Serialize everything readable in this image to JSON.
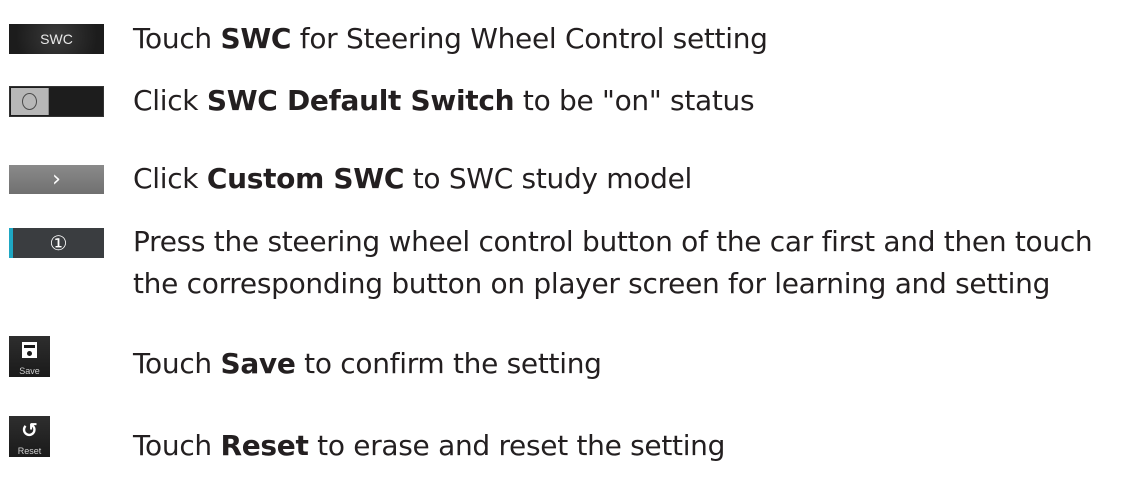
{
  "rows": [
    {
      "icon": {
        "name": "swc-button",
        "label": "SWC"
      },
      "text": {
        "pre": "Touch ",
        "bold": "SWC",
        "post": " for Steering Wheel Control setting"
      }
    },
    {
      "icon": {
        "name": "default-switch-toggle",
        "glyph": "O"
      },
      "text": {
        "pre": "Click ",
        "bold": "SWC Default Switch",
        "post": " to be \"on\" status"
      }
    },
    {
      "icon": {
        "name": "custom-swc-arrow-button",
        "glyph": "›"
      },
      "text": {
        "pre": "Click ",
        "bold": "Custom SWC",
        "post": " to SWC study model"
      }
    },
    {
      "icon": {
        "name": "numbered-button",
        "glyph": "①",
        "accent": "#1ea7c3"
      },
      "text": {
        "line1": "Press the steering wheel control button of the car first and then touch",
        "line2": "the corresponding button on player screen for learning and setting"
      }
    },
    {
      "icon": {
        "name": "save-button",
        "label": "Save"
      },
      "text": {
        "pre": "Touch ",
        "bold": "Save",
        "post": " to confirm the setting"
      }
    },
    {
      "icon": {
        "name": "reset-button",
        "label": "Reset",
        "glyph": "↺"
      },
      "text": {
        "pre": "Touch ",
        "bold": "Reset",
        "post": " to erase and reset the setting"
      }
    }
  ]
}
